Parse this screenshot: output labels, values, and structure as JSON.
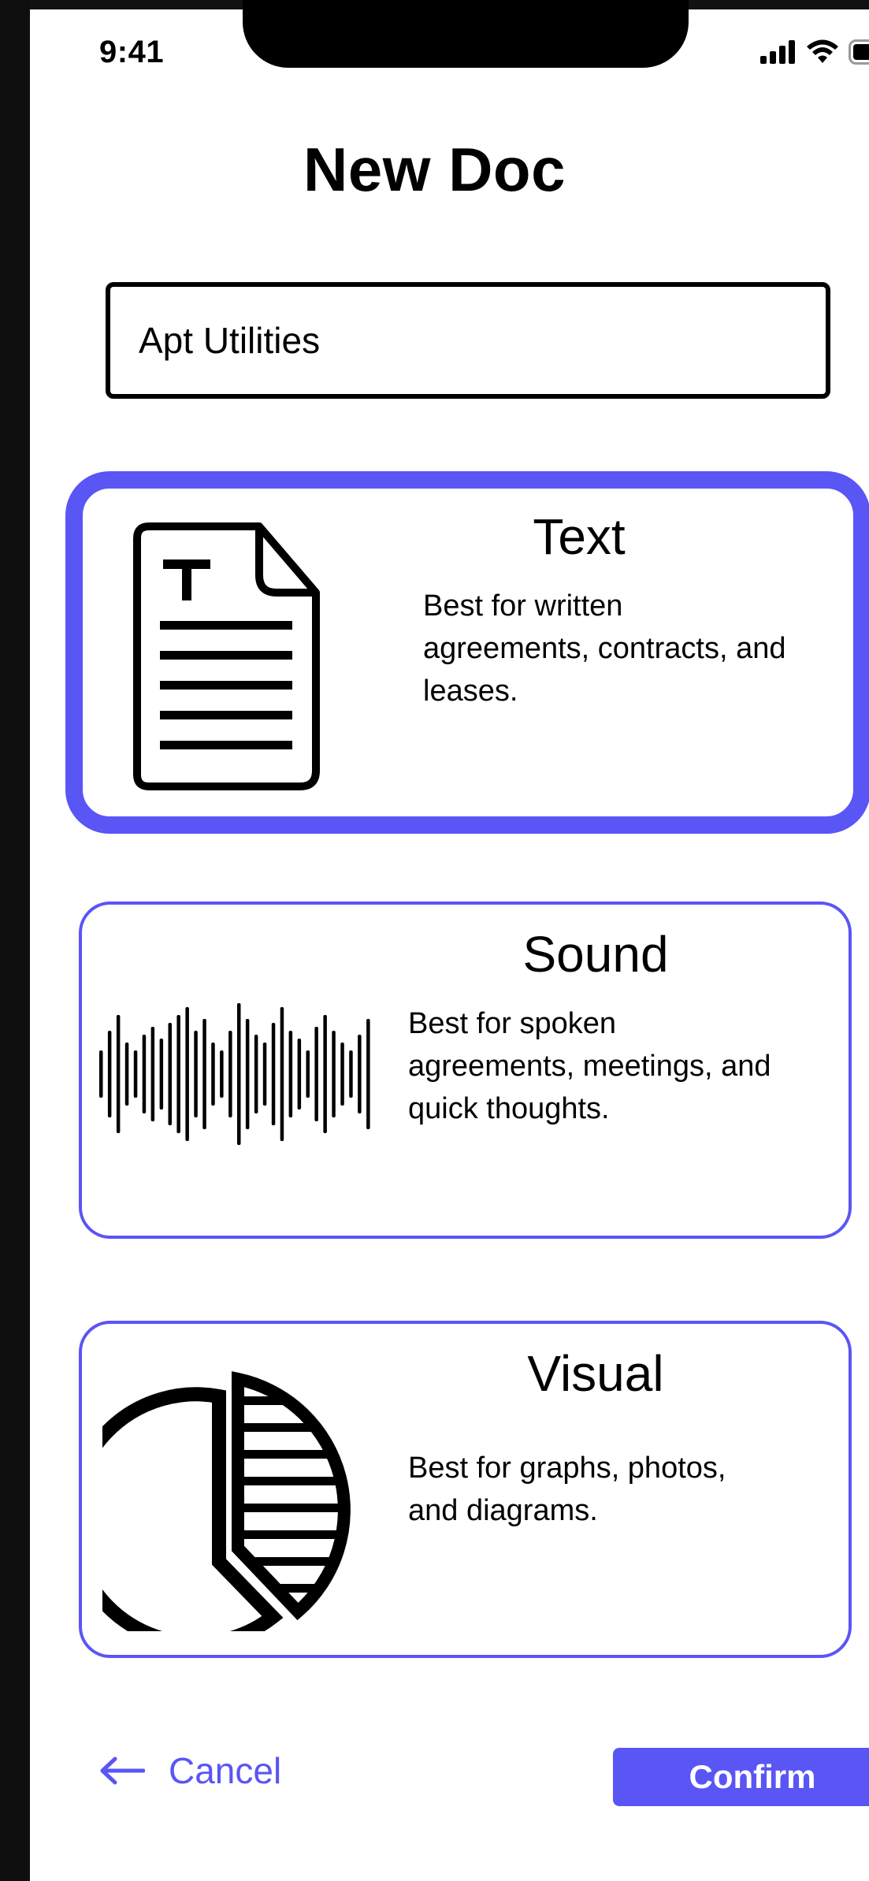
{
  "status_bar": {
    "time": "9:41",
    "icons": [
      "signal-icon",
      "wifi-icon",
      "battery-icon"
    ]
  },
  "header": {
    "title": "New Doc"
  },
  "name_field": {
    "value": "Apt Utilities"
  },
  "doc_types": [
    {
      "title": "Text",
      "description": [
        "Best for written",
        "agreements, contracts, and",
        "leases."
      ],
      "icon": "text-document-icon",
      "selected": true
    },
    {
      "title": "Sound",
      "description": [
        "Best for spoken",
        "agreements, meetings, and",
        "quick thoughts."
      ],
      "icon": "sound-wave-icon",
      "selected": false
    },
    {
      "title": "Visual",
      "description": [
        "Best for graphs, photos,",
        "and diagrams."
      ],
      "icon": "pie-chart-icon",
      "selected": false
    }
  ],
  "footer": {
    "cancel_label": "Cancel",
    "confirm_label": "Confirm"
  },
  "colors": {
    "accent": "#5a55f5",
    "background": "#ffffff",
    "text": "#000000"
  }
}
